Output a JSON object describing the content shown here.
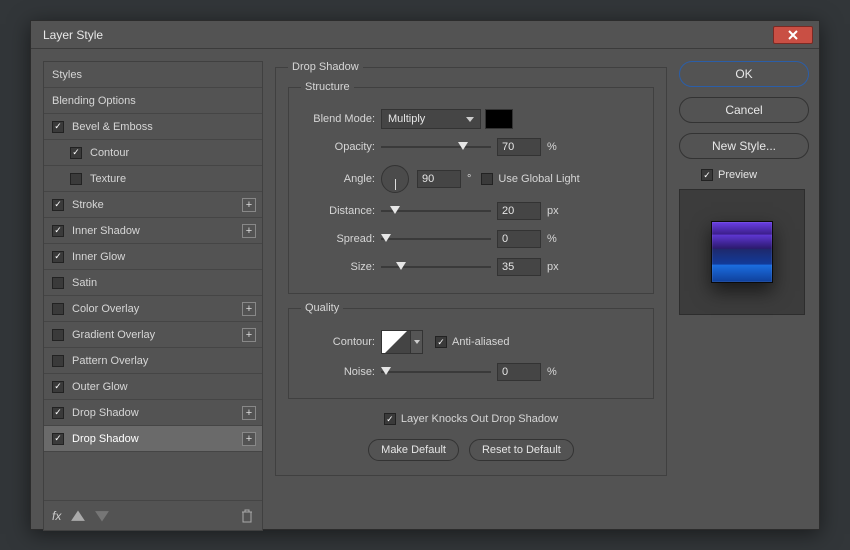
{
  "title": "Layer Style",
  "styles_list": {
    "header": "Styles",
    "blending": "Blending Options",
    "items": [
      {
        "label": "Bevel & Emboss",
        "checked": true,
        "plus": false,
        "indent": 0
      },
      {
        "label": "Contour",
        "checked": true,
        "plus": false,
        "indent": 1
      },
      {
        "label": "Texture",
        "checked": false,
        "plus": false,
        "indent": 1
      },
      {
        "label": "Stroke",
        "checked": true,
        "plus": true,
        "indent": 0
      },
      {
        "label": "Inner Shadow",
        "checked": true,
        "plus": true,
        "indent": 0
      },
      {
        "label": "Inner Glow",
        "checked": true,
        "plus": false,
        "indent": 0
      },
      {
        "label": "Satin",
        "checked": false,
        "plus": false,
        "indent": 0
      },
      {
        "label": "Color Overlay",
        "checked": false,
        "plus": true,
        "indent": 0
      },
      {
        "label": "Gradient Overlay",
        "checked": false,
        "plus": true,
        "indent": 0
      },
      {
        "label": "Pattern Overlay",
        "checked": false,
        "plus": false,
        "indent": 0
      },
      {
        "label": "Outer Glow",
        "checked": true,
        "plus": false,
        "indent": 0
      },
      {
        "label": "Drop Shadow",
        "checked": true,
        "plus": true,
        "indent": 0
      },
      {
        "label": "Drop Shadow",
        "checked": true,
        "plus": true,
        "indent": 0,
        "selected": true
      }
    ]
  },
  "panel": {
    "title": "Drop Shadow",
    "structure": {
      "legend": "Structure",
      "blend_mode_label": "Blend Mode:",
      "blend_mode": "Multiply",
      "opacity_label": "Opacity:",
      "opacity": "70",
      "opacity_unit": "%",
      "angle_label": "Angle:",
      "angle": "90",
      "degree": "°",
      "global_light_label": "Use Global Light",
      "global_light_checked": false,
      "distance_label": "Distance:",
      "distance": "20",
      "px": "px",
      "spread_label": "Spread:",
      "spread": "0",
      "spread_unit": "%",
      "size_label": "Size:",
      "size": "35"
    },
    "quality": {
      "legend": "Quality",
      "contour_label": "Contour:",
      "antialias_label": "Anti-aliased",
      "antialias_checked": true,
      "noise_label": "Noise:",
      "noise": "0",
      "noise_unit": "%"
    },
    "knockout": {
      "checked": true,
      "label": "Layer Knocks Out Drop Shadow"
    },
    "make_default": "Make Default",
    "reset_default": "Reset to Default"
  },
  "right": {
    "ok": "OK",
    "cancel": "Cancel",
    "new_style": "New Style...",
    "preview_label": "Preview",
    "preview_checked": true
  }
}
